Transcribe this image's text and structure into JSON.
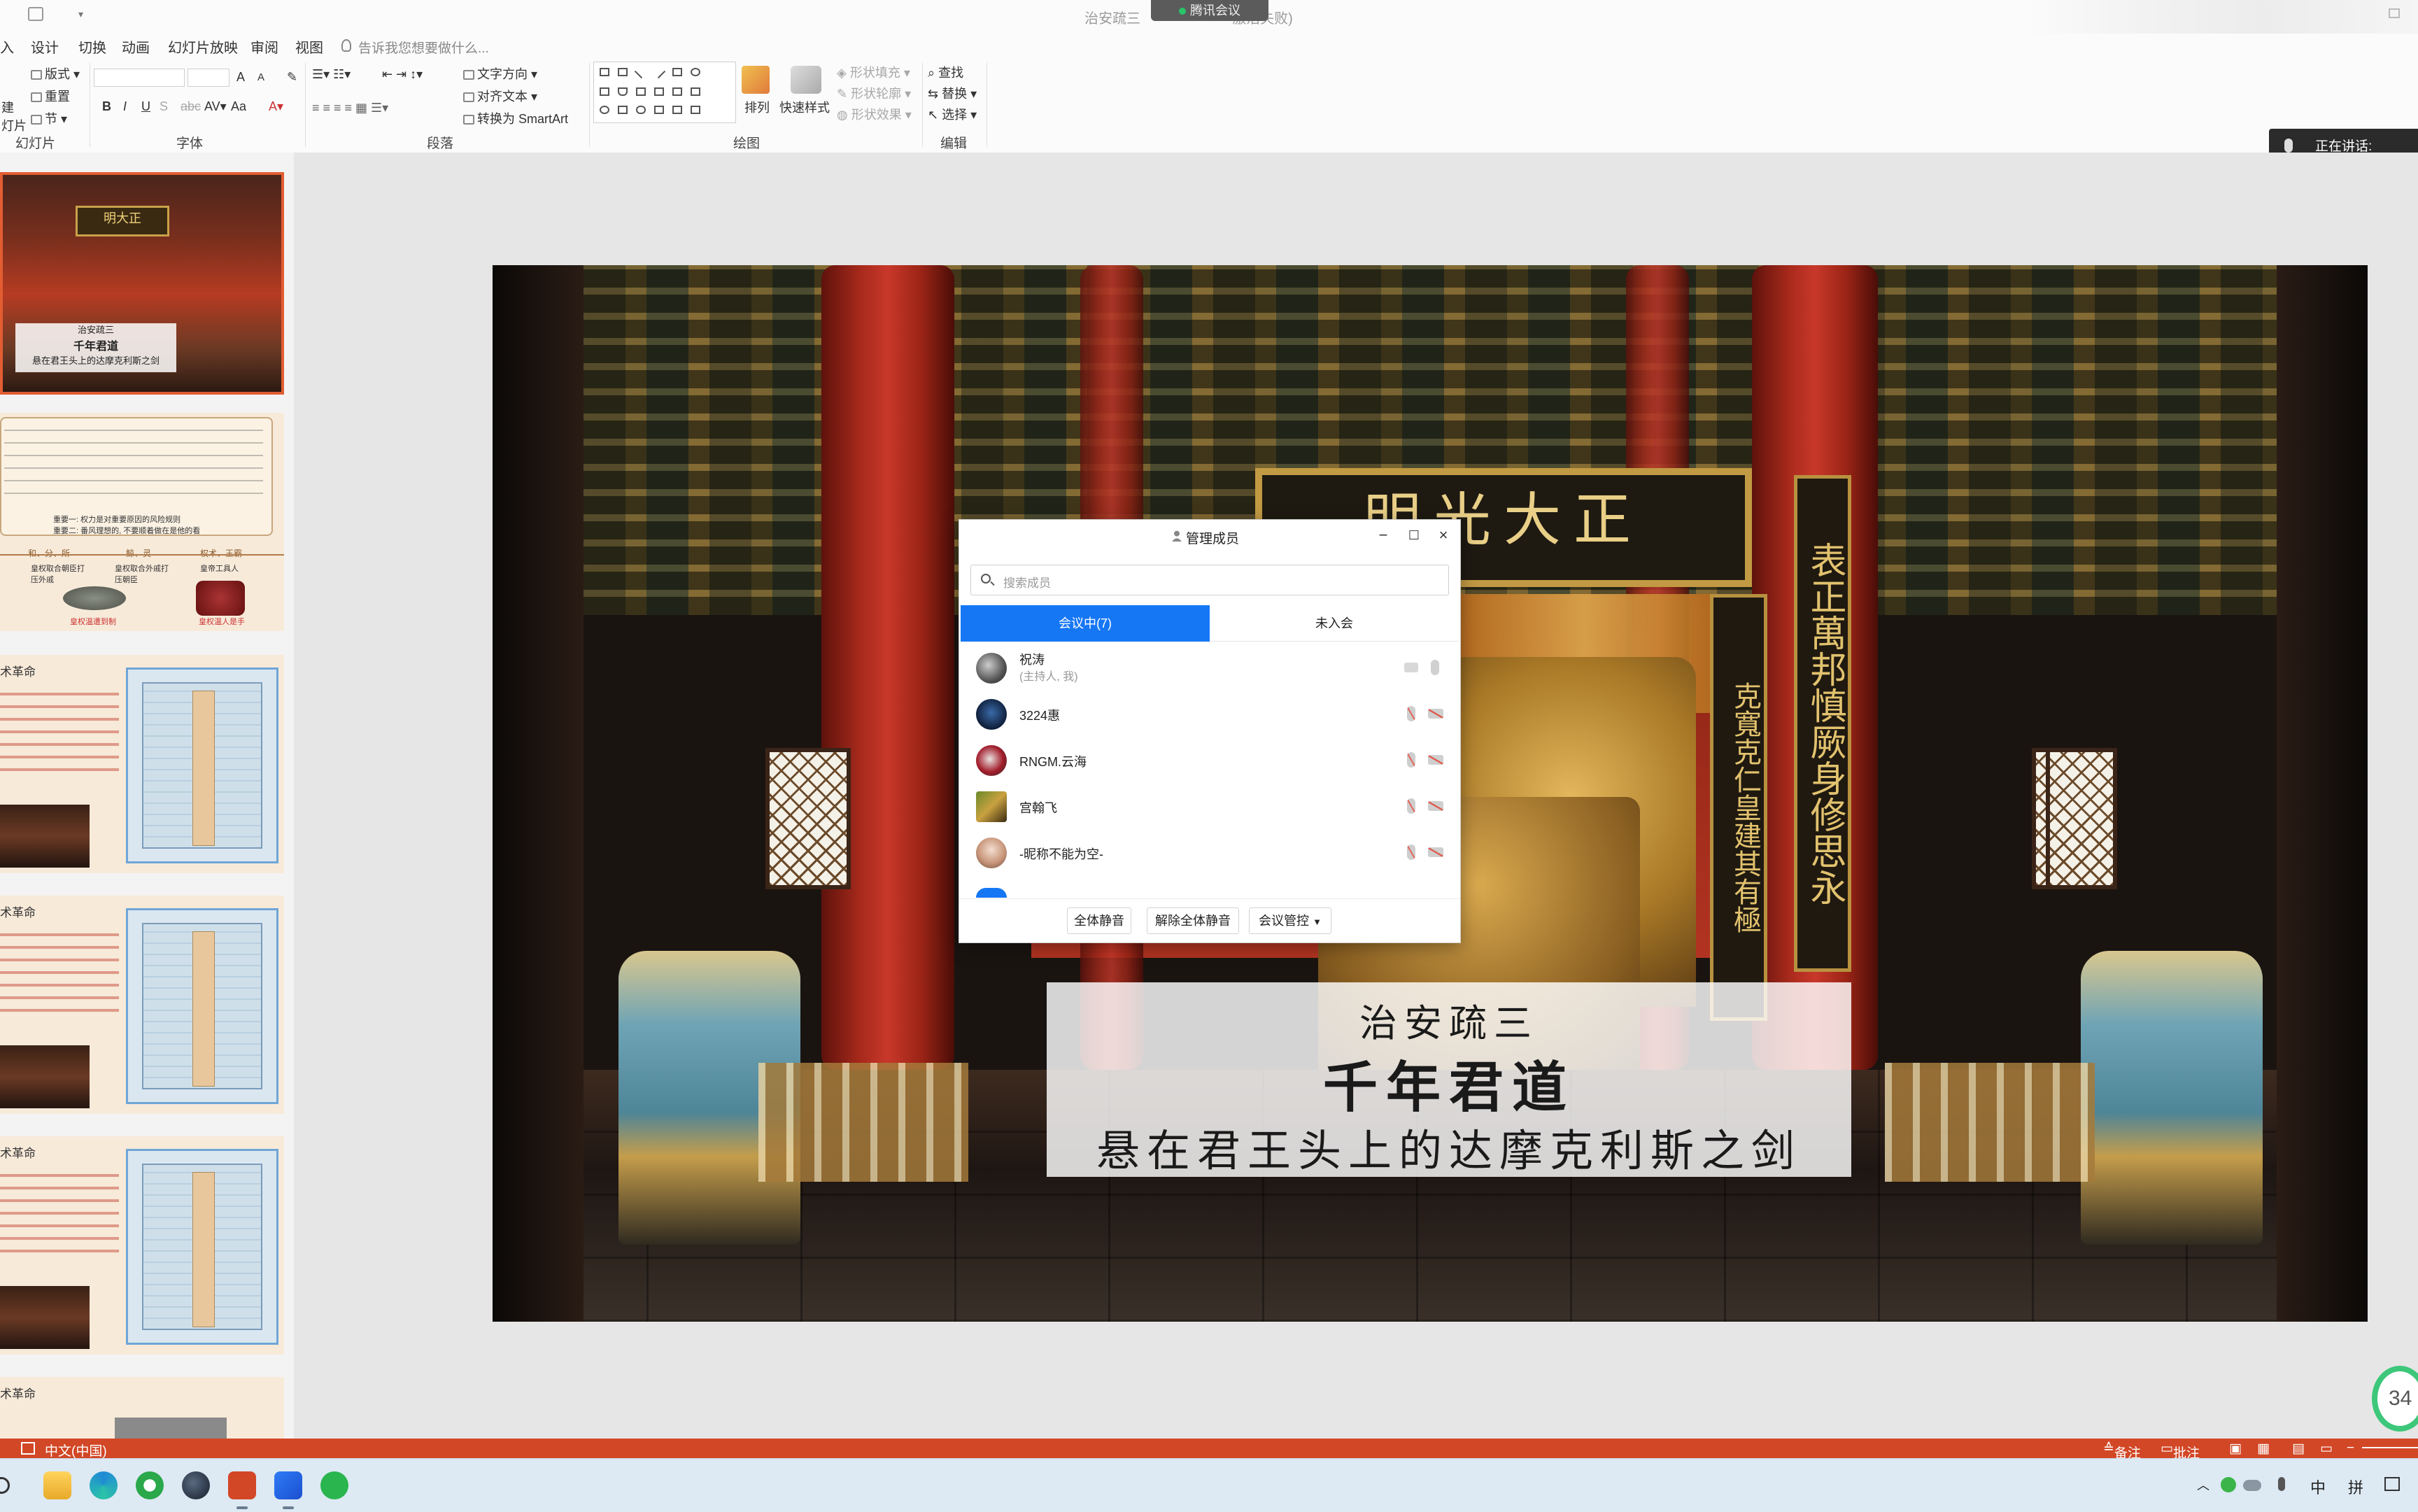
{
  "window": {
    "doc_title": "治安疏三",
    "doc_title_suffix": "激活失败)",
    "meeting_pill": "腾讯会议"
  },
  "menu": {
    "tabs": [
      "入",
      "设计",
      "切换",
      "动画",
      "幻灯片放映",
      "审阅",
      "视图"
    ],
    "tell_me": "告诉我您想要做什么..."
  },
  "ribbon": {
    "slides": {
      "new_1": "建",
      "new_2": "灯片",
      "layout": "版式",
      "reset": "重置",
      "section": "节",
      "label": "幻灯片"
    },
    "font": {
      "label": "字体",
      "bold": "B",
      "italic": "I",
      "underline": "U",
      "grow": "A",
      "shrink": "A",
      "aa": "Aa"
    },
    "paragraph": {
      "label": "段落",
      "text_direction": "文字方向",
      "align_text": "对齐文本",
      "smartart": "转换为 SmartArt"
    },
    "drawing": {
      "label": "绘图",
      "arrange": "排列",
      "quick_styles": "快速样式",
      "shape_fill": "形状填充",
      "shape_outline": "形状轮廓",
      "shape_effects": "形状效果"
    },
    "editing": {
      "label": "编辑",
      "find": "查找",
      "replace": "替换",
      "select": "选择"
    },
    "speaking": "正在讲话:"
  },
  "thumbnails": {
    "t1_plaque": "明大正",
    "t1_cap1": "治安疏三",
    "t1_cap2": "千年君道",
    "t1_cap3": "悬在君王头上的达摩克利斯之剑",
    "t2_note1": "重要一: 权力是对重要原因的风险规则",
    "t2_note2": "重要二: 番风理想的, 不要顺着做在是他的看",
    "t2_labels": [
      "和、分、所",
      "鲸、灵",
      "权术、王霸"
    ],
    "t2_small": [
      "皇权取合朝臣打压外戚",
      "皇权取合外戚打压朝臣",
      "皇帝工具人"
    ],
    "t2_red": [
      "皇权温遭到制",
      "皇权温人是手"
    ],
    "t3_title": "术革命",
    "t4_title": "术革命",
    "t5_title": "术革命",
    "t6_title": "术革命"
  },
  "slide": {
    "plaque": "明光大正",
    "couplet_right": "表正萬邦慎厥身修思永",
    "couplet_left": "克寬克仁皇建其有極",
    "caption_line1": "治安疏三",
    "caption_line2": "千年君道",
    "caption_line3": "悬在君王头上的达摩克利斯之剑"
  },
  "dialog": {
    "title": "管理成员",
    "search_placeholder": "搜索成员",
    "tab_in_meeting": "会议中(7)",
    "tab_not_joined": "未入会",
    "members": [
      {
        "name": "祝涛",
        "sub": "(主持人, 我)"
      },
      {
        "name": "3224惠",
        "sub": ""
      },
      {
        "name": "RNGM.云海",
        "sub": ""
      },
      {
        "name": "宫翰飞",
        "sub": ""
      },
      {
        "name": "-昵称不能为空-",
        "sub": ""
      }
    ],
    "btn_mute_all": "全体静音",
    "btn_unmute_all": "解除全体静音",
    "btn_controls": "会议管控"
  },
  "statusbar": {
    "language": "中文(中国)",
    "notes": "备注",
    "comments": "批注"
  },
  "taskbar": {
    "ime_zh": "中",
    "ime_pinyin": "拼",
    "badge": "34"
  },
  "colors": {
    "accent_blue": "#1677f5",
    "status_orange": "#d24726",
    "badge_green": "#3dc77a"
  }
}
